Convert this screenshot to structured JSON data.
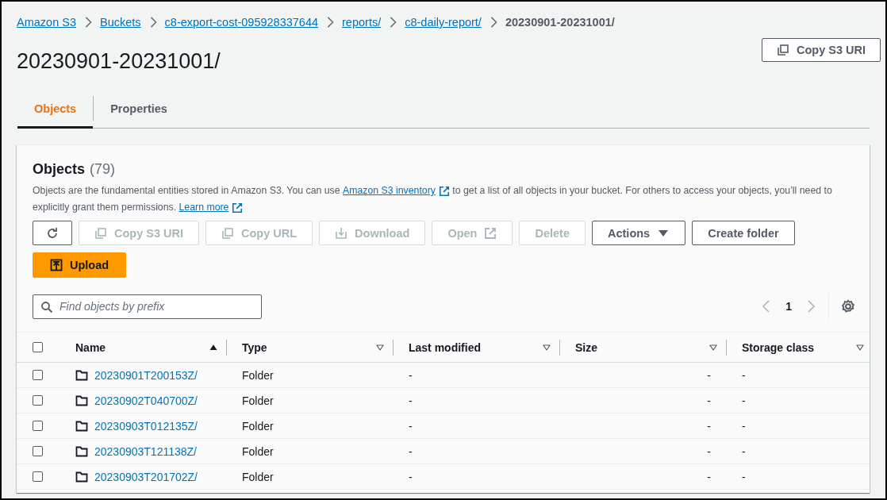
{
  "breadcrumbs": [
    {
      "label": "Amazon S3",
      "kind": "link"
    },
    {
      "label": "Buckets",
      "kind": "link"
    },
    {
      "label": "c8-export-cost-095928337644",
      "kind": "link"
    },
    {
      "label": "reports/",
      "kind": "link"
    },
    {
      "label": "c8-daily-report/",
      "kind": "link"
    },
    {
      "label": "20230901-20231001/",
      "kind": "current"
    }
  ],
  "title": "20230901-20231001/",
  "header_button": {
    "label": "Copy S3 URI"
  },
  "tabs": [
    {
      "label": "Objects",
      "selected": true
    },
    {
      "label": "Properties",
      "selected": false
    }
  ],
  "objects_panel": {
    "heading": "Objects",
    "count": "(79)",
    "description": [
      {
        "kind": "text",
        "text": "Objects are the fundamental entities stored in Amazon S3. You can use "
      },
      {
        "kind": "link",
        "text": "Amazon S3 inventory",
        "external": true
      },
      {
        "kind": "text",
        "text": " to get a list of all objects in your bucket. For others to access your objects, you’ll need to explicitly grant them permissions. "
      },
      {
        "kind": "link",
        "text": "Learn more",
        "external": true
      }
    ],
    "toolbar": [
      {
        "kind": "refresh",
        "disabled": false
      },
      {
        "kind": "copy",
        "label": "Copy S3 URI",
        "disabled": true
      },
      {
        "kind": "copy",
        "label": "Copy URL",
        "disabled": true
      },
      {
        "kind": "download",
        "label": "Download",
        "disabled": true
      },
      {
        "kind": "external",
        "label": "Open",
        "disabled": true
      },
      {
        "kind": "plain",
        "label": "Delete",
        "disabled": true
      },
      {
        "kind": "dropdown",
        "label": "Actions",
        "disabled": false
      },
      {
        "kind": "plain",
        "label": "Create folder",
        "disabled": false
      }
    ],
    "upload_button": {
      "label": "Upload"
    }
  },
  "search": {
    "placeholder": "Find objects by prefix"
  },
  "pagination": {
    "previous": {
      "disabled": true
    },
    "pages": [
      {
        "label": "1",
        "selected": true
      }
    ],
    "next": {
      "disabled": true
    }
  },
  "table": {
    "select_all": {
      "checked": false
    },
    "columns": [
      {
        "label": "Name",
        "sorted": true
      },
      {
        "label": "Type",
        "sorted": false
      },
      {
        "label": "Last modified",
        "sorted": false
      },
      {
        "label": "Size",
        "sorted": false
      },
      {
        "label": "Storage class",
        "sorted": false
      }
    ],
    "rows": [
      {
        "checked": false,
        "kind": "folder",
        "name": "20230901T200153Z/",
        "type": "Folder",
        "last_modified": "-",
        "size": "-",
        "storage_class": "-"
      },
      {
        "checked": false,
        "kind": "folder",
        "name": "20230902T040700Z/",
        "type": "Folder",
        "last_modified": "-",
        "size": "-",
        "storage_class": "-"
      },
      {
        "checked": false,
        "kind": "folder",
        "name": "20230903T012135Z/",
        "type": "Folder",
        "last_modified": "-",
        "size": "-",
        "storage_class": "-"
      },
      {
        "checked": false,
        "kind": "folder",
        "name": "20230903T121138Z/",
        "type": "Folder",
        "last_modified": "-",
        "size": "-",
        "storage_class": "-"
      },
      {
        "checked": false,
        "kind": "folder",
        "name": "20230903T201702Z/",
        "type": "Folder",
        "last_modified": "-",
        "size": "-",
        "storage_class": "-"
      }
    ]
  }
}
